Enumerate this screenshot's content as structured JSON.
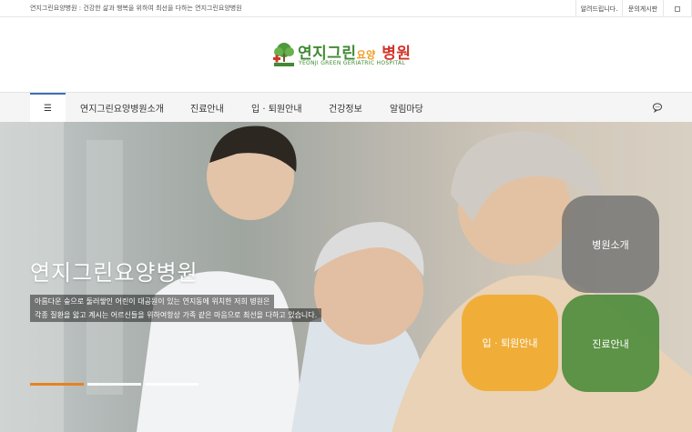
{
  "topbar": {
    "tagline": "연지그린요양병원 : 건강한 삶과 행복을 위하여 최선을 다하는 연지그린요양병원",
    "links": [
      "알려드립니다.",
      "문의게시판"
    ],
    "menu_icon": "grid-icon"
  },
  "logo": {
    "name_part1": "연지그린",
    "name_part2": "요양",
    "name_part3": "병원",
    "subtitle": "YEONJI GREEN GERIATRIC HOSPITAL",
    "emblem": "tree-cross-emblem",
    "colors": {
      "green": "#3f8a33",
      "orange": "#f29b1d",
      "red": "#d2352b"
    }
  },
  "nav": {
    "menu_icon": "hamburger-icon",
    "items": [
      "연지그린요양병원소개",
      "진료안내",
      "입 · 퇴원안내",
      "건강정보",
      "알림마당"
    ],
    "chat_icon": "chat-bubble-icon"
  },
  "hero": {
    "title": "연지그린요양병원",
    "caption_line1": "아름다운 숲으로 둘러쌓인 어린이 대공원이 있는 연지동에 위치한 저희 병원은",
    "caption_line2": "각종 질환을 앓고 계시는 어르신들을 위하여항상 가족 같은 마음으로 최선을 다하고 있습니다.",
    "slide_indicator": {
      "count": 3,
      "active_index": 0,
      "active_color": "#e8821f"
    },
    "tiles": [
      {
        "label": "병원소개",
        "color": "#6e6e6e"
      },
      {
        "label": "입 · 퇴원안내",
        "color": "#f0a828"
      },
      {
        "label": "진료안내",
        "color": "#4c8c3a"
      }
    ]
  }
}
